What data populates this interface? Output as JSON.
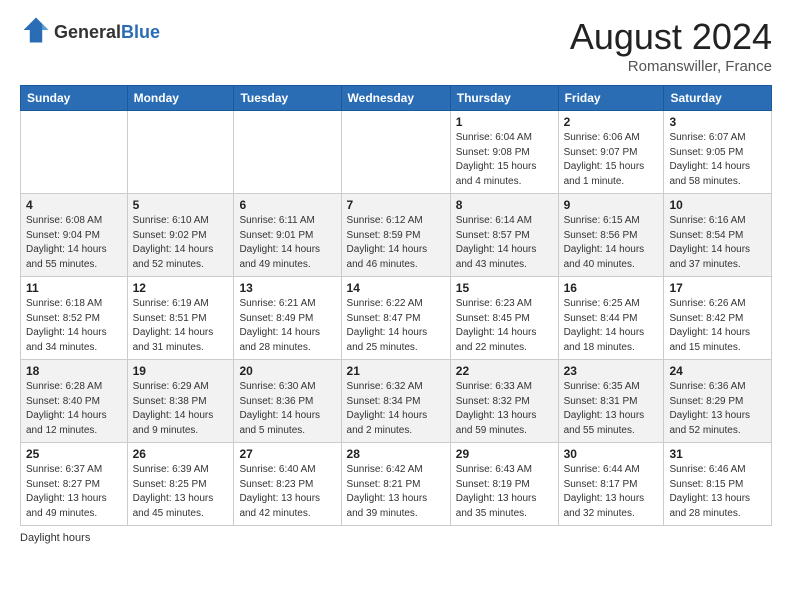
{
  "header": {
    "logo_line1": "General",
    "logo_line2": "Blue",
    "month_title": "August 2024",
    "location": "Romanswiller, France"
  },
  "days_of_week": [
    "Sunday",
    "Monday",
    "Tuesday",
    "Wednesday",
    "Thursday",
    "Friday",
    "Saturday"
  ],
  "weeks": [
    [
      {
        "day": "",
        "info": ""
      },
      {
        "day": "",
        "info": ""
      },
      {
        "day": "",
        "info": ""
      },
      {
        "day": "",
        "info": ""
      },
      {
        "day": "1",
        "info": "Sunrise: 6:04 AM\nSunset: 9:08 PM\nDaylight: 15 hours\nand 4 minutes."
      },
      {
        "day": "2",
        "info": "Sunrise: 6:06 AM\nSunset: 9:07 PM\nDaylight: 15 hours\nand 1 minute."
      },
      {
        "day": "3",
        "info": "Sunrise: 6:07 AM\nSunset: 9:05 PM\nDaylight: 14 hours\nand 58 minutes."
      }
    ],
    [
      {
        "day": "4",
        "info": "Sunrise: 6:08 AM\nSunset: 9:04 PM\nDaylight: 14 hours\nand 55 minutes."
      },
      {
        "day": "5",
        "info": "Sunrise: 6:10 AM\nSunset: 9:02 PM\nDaylight: 14 hours\nand 52 minutes."
      },
      {
        "day": "6",
        "info": "Sunrise: 6:11 AM\nSunset: 9:01 PM\nDaylight: 14 hours\nand 49 minutes."
      },
      {
        "day": "7",
        "info": "Sunrise: 6:12 AM\nSunset: 8:59 PM\nDaylight: 14 hours\nand 46 minutes."
      },
      {
        "day": "8",
        "info": "Sunrise: 6:14 AM\nSunset: 8:57 PM\nDaylight: 14 hours\nand 43 minutes."
      },
      {
        "day": "9",
        "info": "Sunrise: 6:15 AM\nSunset: 8:56 PM\nDaylight: 14 hours\nand 40 minutes."
      },
      {
        "day": "10",
        "info": "Sunrise: 6:16 AM\nSunset: 8:54 PM\nDaylight: 14 hours\nand 37 minutes."
      }
    ],
    [
      {
        "day": "11",
        "info": "Sunrise: 6:18 AM\nSunset: 8:52 PM\nDaylight: 14 hours\nand 34 minutes."
      },
      {
        "day": "12",
        "info": "Sunrise: 6:19 AM\nSunset: 8:51 PM\nDaylight: 14 hours\nand 31 minutes."
      },
      {
        "day": "13",
        "info": "Sunrise: 6:21 AM\nSunset: 8:49 PM\nDaylight: 14 hours\nand 28 minutes."
      },
      {
        "day": "14",
        "info": "Sunrise: 6:22 AM\nSunset: 8:47 PM\nDaylight: 14 hours\nand 25 minutes."
      },
      {
        "day": "15",
        "info": "Sunrise: 6:23 AM\nSunset: 8:45 PM\nDaylight: 14 hours\nand 22 minutes."
      },
      {
        "day": "16",
        "info": "Sunrise: 6:25 AM\nSunset: 8:44 PM\nDaylight: 14 hours\nand 18 minutes."
      },
      {
        "day": "17",
        "info": "Sunrise: 6:26 AM\nSunset: 8:42 PM\nDaylight: 14 hours\nand 15 minutes."
      }
    ],
    [
      {
        "day": "18",
        "info": "Sunrise: 6:28 AM\nSunset: 8:40 PM\nDaylight: 14 hours\nand 12 minutes."
      },
      {
        "day": "19",
        "info": "Sunrise: 6:29 AM\nSunset: 8:38 PM\nDaylight: 14 hours\nand 9 minutes."
      },
      {
        "day": "20",
        "info": "Sunrise: 6:30 AM\nSunset: 8:36 PM\nDaylight: 14 hours\nand 5 minutes."
      },
      {
        "day": "21",
        "info": "Sunrise: 6:32 AM\nSunset: 8:34 PM\nDaylight: 14 hours\nand 2 minutes."
      },
      {
        "day": "22",
        "info": "Sunrise: 6:33 AM\nSunset: 8:32 PM\nDaylight: 13 hours\nand 59 minutes."
      },
      {
        "day": "23",
        "info": "Sunrise: 6:35 AM\nSunset: 8:31 PM\nDaylight: 13 hours\nand 55 minutes."
      },
      {
        "day": "24",
        "info": "Sunrise: 6:36 AM\nSunset: 8:29 PM\nDaylight: 13 hours\nand 52 minutes."
      }
    ],
    [
      {
        "day": "25",
        "info": "Sunrise: 6:37 AM\nSunset: 8:27 PM\nDaylight: 13 hours\nand 49 minutes."
      },
      {
        "day": "26",
        "info": "Sunrise: 6:39 AM\nSunset: 8:25 PM\nDaylight: 13 hours\nand 45 minutes."
      },
      {
        "day": "27",
        "info": "Sunrise: 6:40 AM\nSunset: 8:23 PM\nDaylight: 13 hours\nand 42 minutes."
      },
      {
        "day": "28",
        "info": "Sunrise: 6:42 AM\nSunset: 8:21 PM\nDaylight: 13 hours\nand 39 minutes."
      },
      {
        "day": "29",
        "info": "Sunrise: 6:43 AM\nSunset: 8:19 PM\nDaylight: 13 hours\nand 35 minutes."
      },
      {
        "day": "30",
        "info": "Sunrise: 6:44 AM\nSunset: 8:17 PM\nDaylight: 13 hours\nand 32 minutes."
      },
      {
        "day": "31",
        "info": "Sunrise: 6:46 AM\nSunset: 8:15 PM\nDaylight: 13 hours\nand 28 minutes."
      }
    ]
  ],
  "footer": {
    "daylight_label": "Daylight hours"
  }
}
